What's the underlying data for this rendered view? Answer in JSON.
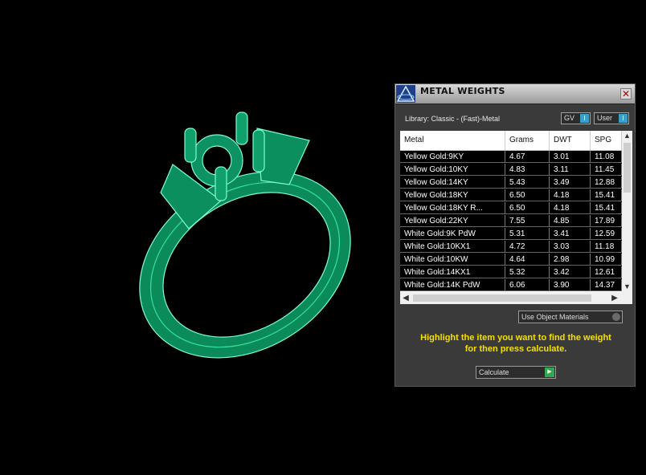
{
  "panel": {
    "title": "METAL WEIGHTS",
    "close_icon": "close-icon",
    "logo_icon": "app-logo-icon",
    "library_label": "Library: Classic - (Fast)-Metal",
    "toggles": {
      "gv": "GV",
      "user": "User"
    },
    "table": {
      "headers": [
        "Metal",
        "Grams",
        "DWT",
        "SPG"
      ],
      "rows": [
        [
          "Yellow Gold:9KY",
          "4.67",
          "3.01",
          "11.08"
        ],
        [
          "Yellow Gold:10KY",
          "4.83",
          "3.11",
          "11.45"
        ],
        [
          "Yellow Gold:14KY",
          "5.43",
          "3.49",
          "12.88"
        ],
        [
          "Yellow Gold:18KY",
          "6.50",
          "4.18",
          "15.41"
        ],
        [
          "Yellow Gold:18KY R...",
          "6.50",
          "4.18",
          "15.41"
        ],
        [
          "Yellow Gold:22KY",
          "7.55",
          "4.85",
          "17.89"
        ],
        [
          "White Gold:9K PdW",
          "5.31",
          "3.41",
          "12.59"
        ],
        [
          "White Gold:10KX1",
          "4.72",
          "3.03",
          "11.18"
        ],
        [
          "White Gold:10KW",
          "4.64",
          "2.98",
          "10.99"
        ],
        [
          "White Gold:14KX1",
          "5.32",
          "3.42",
          "12.61"
        ],
        [
          "White Gold:14K PdW",
          "6.06",
          "3.90",
          "14.37"
        ]
      ]
    },
    "use_object_materials": "Use Object Materials",
    "hint_line1": "Highlight the item you want to find the weight",
    "hint_line2": "for then press calculate.",
    "calculate_label": "Calculate",
    "colors": {
      "hint": "#f5e000",
      "toggle_on": "#3aa0c8",
      "go": "#2fa84f",
      "ring": "#0a8c5a"
    }
  }
}
